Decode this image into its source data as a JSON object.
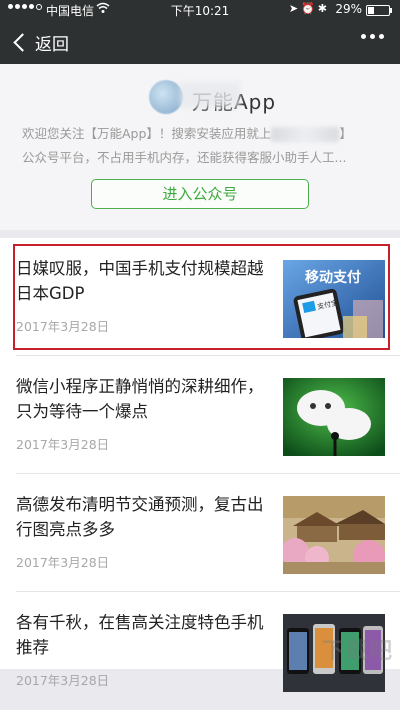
{
  "status_bar": {
    "carrier": "中国电信",
    "time": "下午10:21",
    "battery": "29%",
    "battery_level": 0.29,
    "signal_bars_filled": 4,
    "signal_bars_total": 5
  },
  "nav": {
    "back_label": "返回",
    "more_icon": "more-dots-icon"
  },
  "account": {
    "name": "万能App",
    "intro_line1_a": "欢迎您关注【万能App】！搜索安装应用就上",
    "intro_line1_b": "】",
    "intro_line2": "公众号平台，不占用手机内存，还能获得客服小助手人工...",
    "enter_button": "进入公众号"
  },
  "articles": [
    {
      "title": "日媒叹服，中国手机支付规模超越日本GDP",
      "date": "2017年3月28日",
      "thumb_text": "移动支付",
      "thumb_sub": "支付宝"
    },
    {
      "title": "微信小程序正静悄悄的深耕细作，只为等待一个爆点",
      "date": "2017年3月28日"
    },
    {
      "title": "高德发布清明节交通预测，复古出行图亮点多多",
      "date": "2017年3月28日"
    },
    {
      "title": "各有千秋，在售高关注度特色手机推荐",
      "date": "2017年3月28日"
    }
  ],
  "colors": {
    "nav_bg": "#2e3132",
    "accent_green": "#3caa3c",
    "highlight_red": "#c8202b"
  }
}
